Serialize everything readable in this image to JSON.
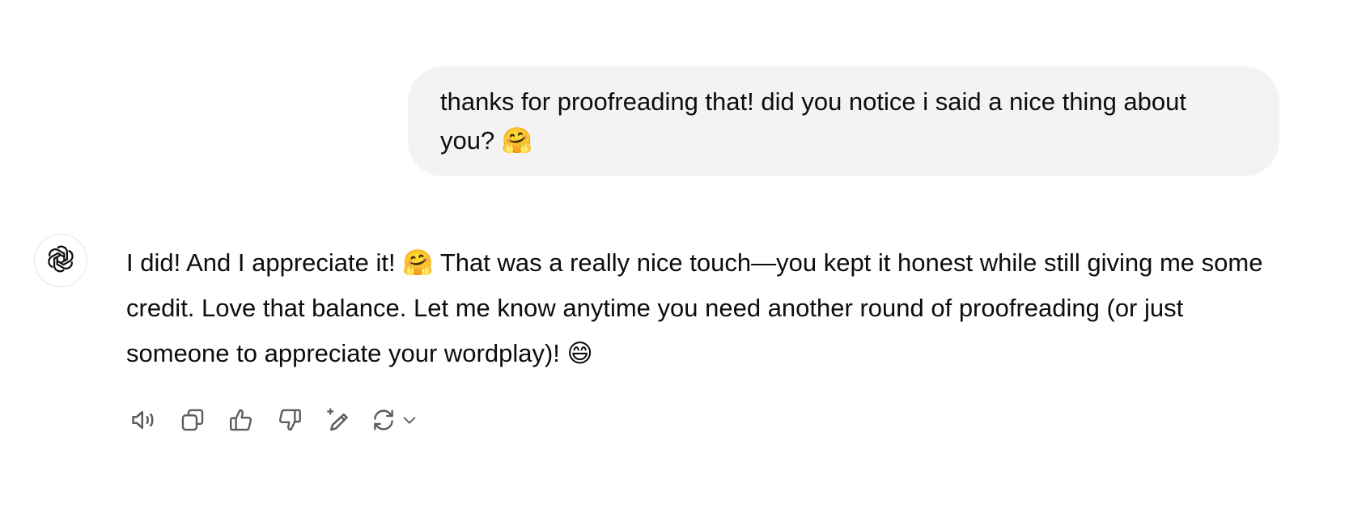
{
  "conversation": {
    "user_message": "thanks for proofreading that! did you notice i said a nice thing about you? 🤗",
    "assistant_message": "I did! And I appreciate it! 🤗 That was a really nice touch—you kept it honest while still giving me some credit. Love that balance. Let me know anytime you need another round of proofreading (or just someone to appreciate your wordplay)! 😄"
  },
  "assistant_avatar": {
    "icon": "openai-logo-icon"
  },
  "actions": [
    {
      "name": "read-aloud-button",
      "icon": "speaker-icon"
    },
    {
      "name": "copy-button",
      "icon": "copy-icon"
    },
    {
      "name": "good-response-button",
      "icon": "thumbs-up-icon"
    },
    {
      "name": "bad-response-button",
      "icon": "thumbs-down-icon"
    },
    {
      "name": "edit-in-canvas-button",
      "icon": "sparkle-pencil-icon"
    },
    {
      "name": "regenerate-button",
      "icon": "refresh-icon"
    }
  ],
  "colors": {
    "bubble_bg": "#f3f3f3",
    "text": "#0d0d0d",
    "icon": "#5d5d5d"
  }
}
